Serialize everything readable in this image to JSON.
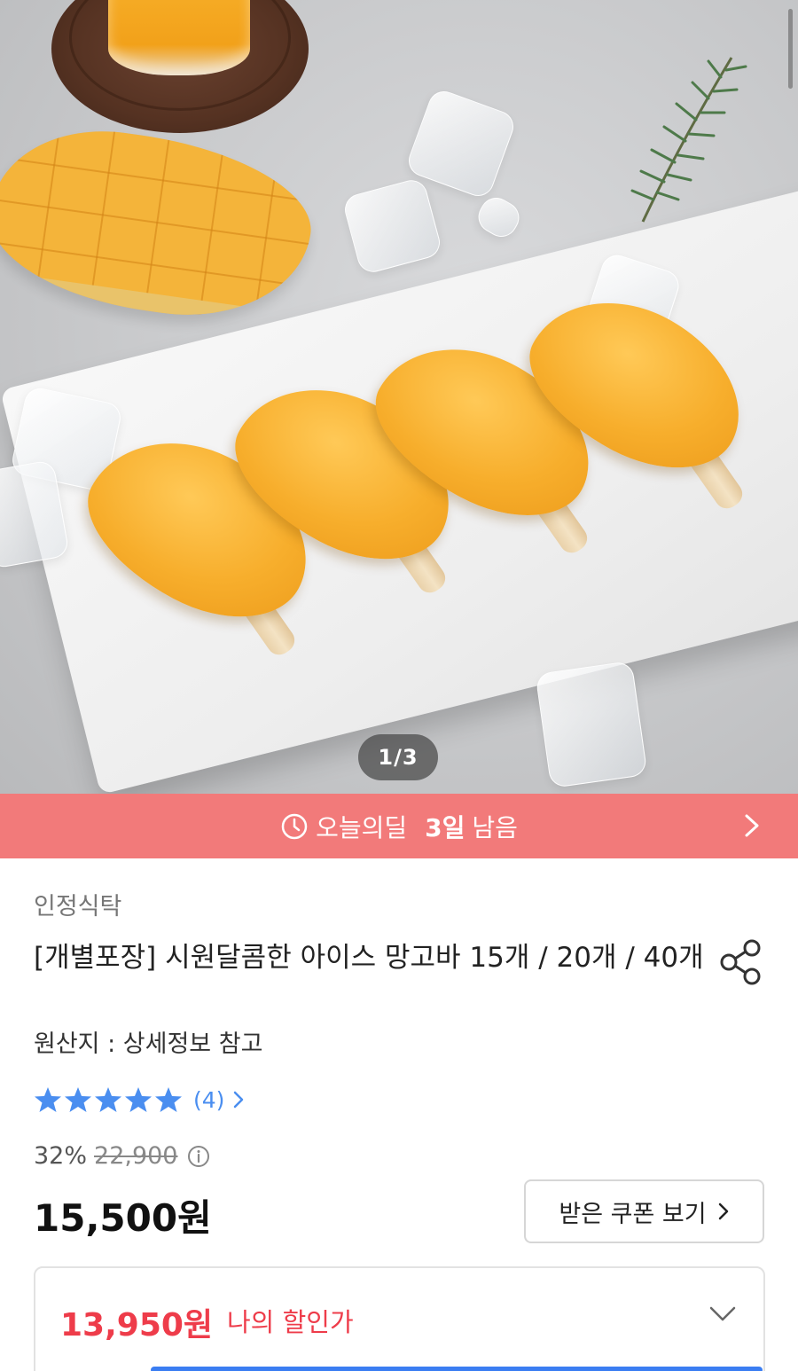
{
  "gallery": {
    "page_indicator": "1/3"
  },
  "deal_banner": {
    "title": "오늘의딜",
    "days_left": "3일",
    "remaining_label": "남음",
    "background_color": "#f27a7a"
  },
  "product": {
    "seller": "인정식탁",
    "title": "[개별포장] 시원달콤한 아이스 망고바 15개 / 20개 / 40개",
    "origin": "원산지 : 상세정보 참고",
    "rating": {
      "stars": 5,
      "review_count": "(4)"
    },
    "discount_rate": "32%",
    "original_price": "22,900",
    "price": "15,500원",
    "coupon_button_label": "받은 쿠폰 보기",
    "my_price": "13,950원",
    "my_price_label": "나의 할인가"
  },
  "colors": {
    "accent_red": "#ee3c4a",
    "link_blue": "#4a8ef0"
  },
  "icons": {
    "deal_clock": "clock-icon",
    "deal_arrow": "chevron-right-icon",
    "share": "share-icon",
    "review_arrow": "chevron-right-icon",
    "info": "info-icon",
    "coupon_arrow": "chevron-right-icon",
    "my_price_toggle": "chevron-down-icon"
  }
}
